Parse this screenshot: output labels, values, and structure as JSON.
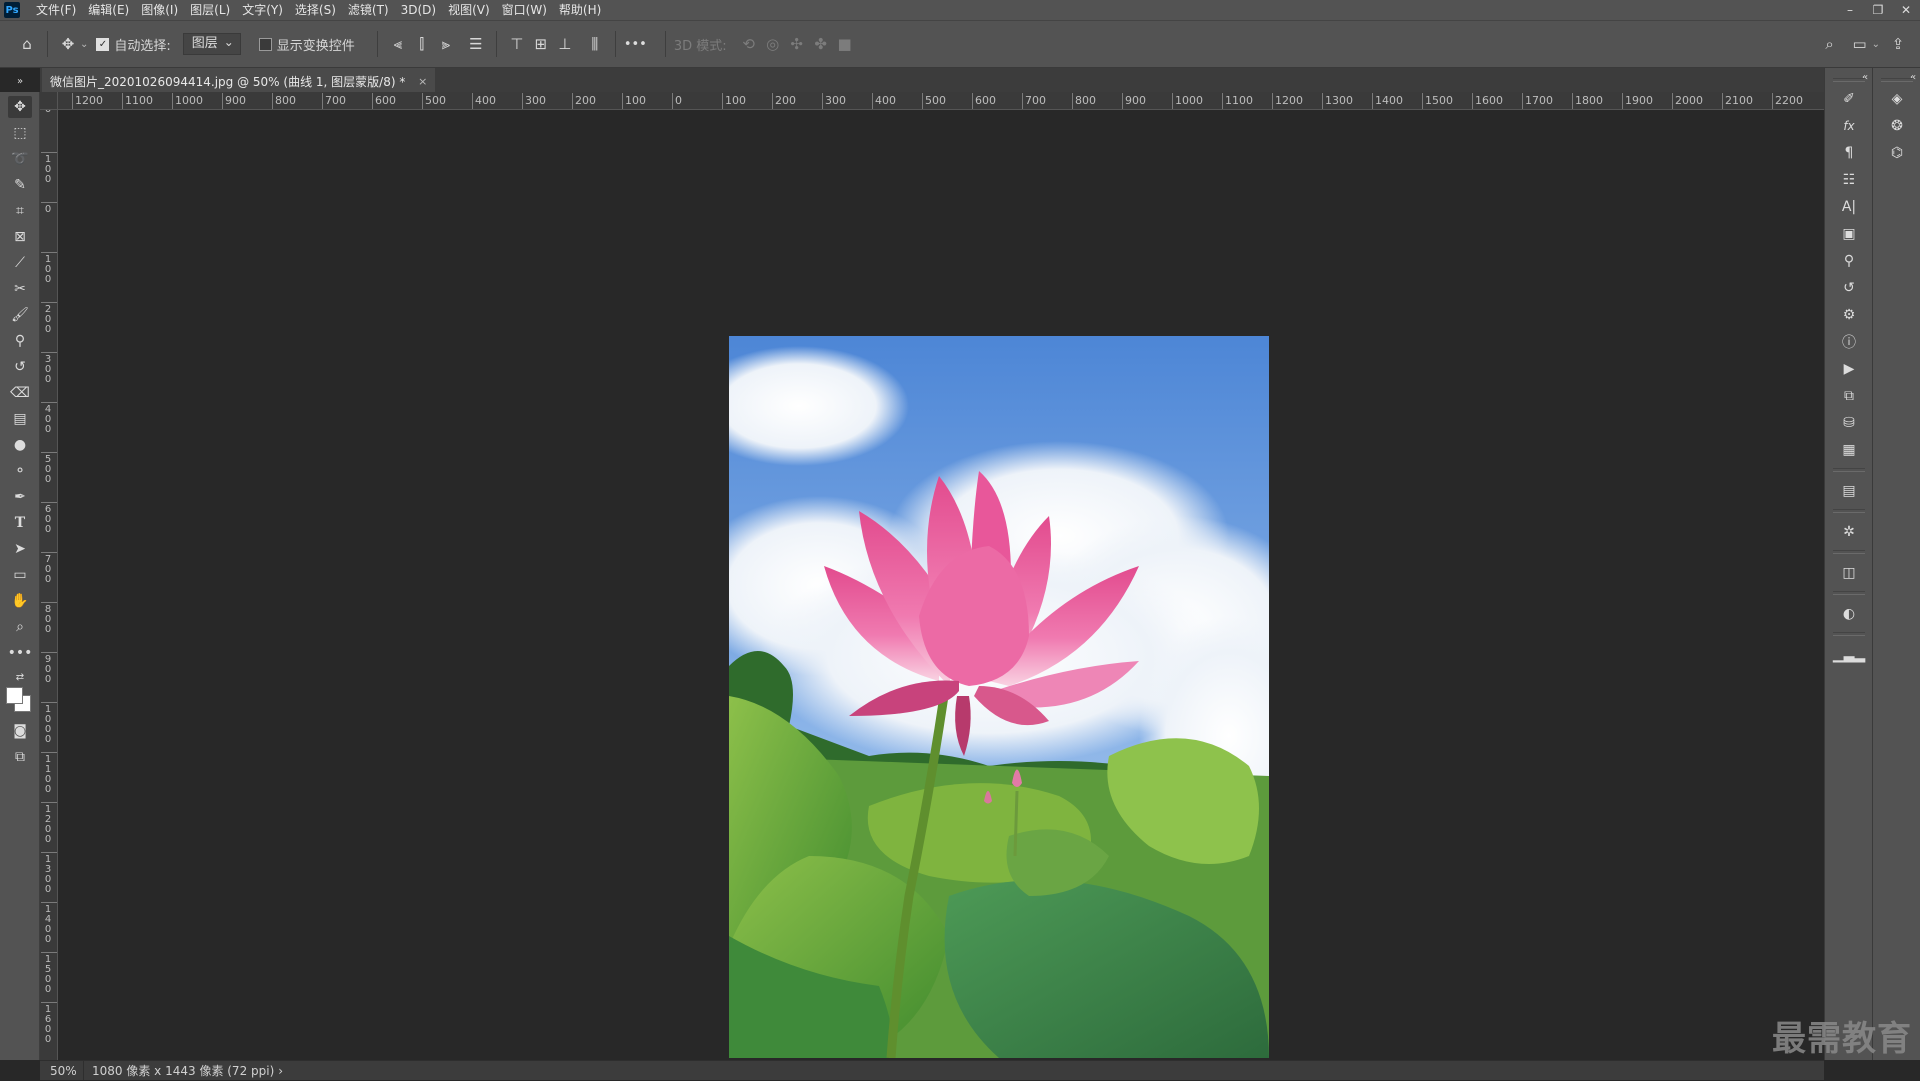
{
  "app": {
    "logo": "Ps"
  },
  "menu": [
    "文件(F)",
    "编辑(E)",
    "图像(I)",
    "图层(L)",
    "文字(Y)",
    "选择(S)",
    "滤镜(T)",
    "3D(D)",
    "视图(V)",
    "窗口(W)",
    "帮助(H)"
  ],
  "window_controls": {
    "minimize": "–",
    "restore": "❐",
    "close": "✕"
  },
  "options": {
    "auto_select_label": "自动选择:",
    "auto_select_checked": true,
    "auto_select_value": "图层",
    "show_transform_label": "显示变换控件",
    "show_transform_checked": false,
    "more": "•••",
    "mode_3d_label": "3D 模式:"
  },
  "document": {
    "tab_title": "微信图片_20201026094414.jpg @ 50% (曲线 1, 图层蒙版/8) *",
    "close": "×"
  },
  "ruler_top": [
    "1200",
    "1100",
    "1000",
    "900",
    "800",
    "700",
    "600",
    "500",
    "400",
    "300",
    "200",
    "100",
    "0",
    "100",
    "200",
    "300",
    "400",
    "500",
    "600",
    "700",
    "800",
    "900",
    "1000",
    "1100",
    "1200",
    "1300",
    "1400",
    "1500",
    "1600",
    "1700",
    "1800",
    "1900",
    "2000",
    "2100",
    "2200"
  ],
  "ruler_left": [
    "0",
    "100",
    "0",
    "100",
    "200",
    "300",
    "400",
    "500",
    "600",
    "700",
    "800",
    "900",
    "1000",
    "1100",
    "1200",
    "1300",
    "1400",
    "1500",
    "1600"
  ],
  "status": {
    "zoom": "50%",
    "doc_info": "1080 像素 x 1443 像素 (72 ppi)",
    "arrow": "›"
  },
  "watermark": "最需教育",
  "colors": {
    "foreground": "#ffffff",
    "background": "#ffffff",
    "ui_panel": "#535353",
    "canvas_bg": "#282828"
  }
}
